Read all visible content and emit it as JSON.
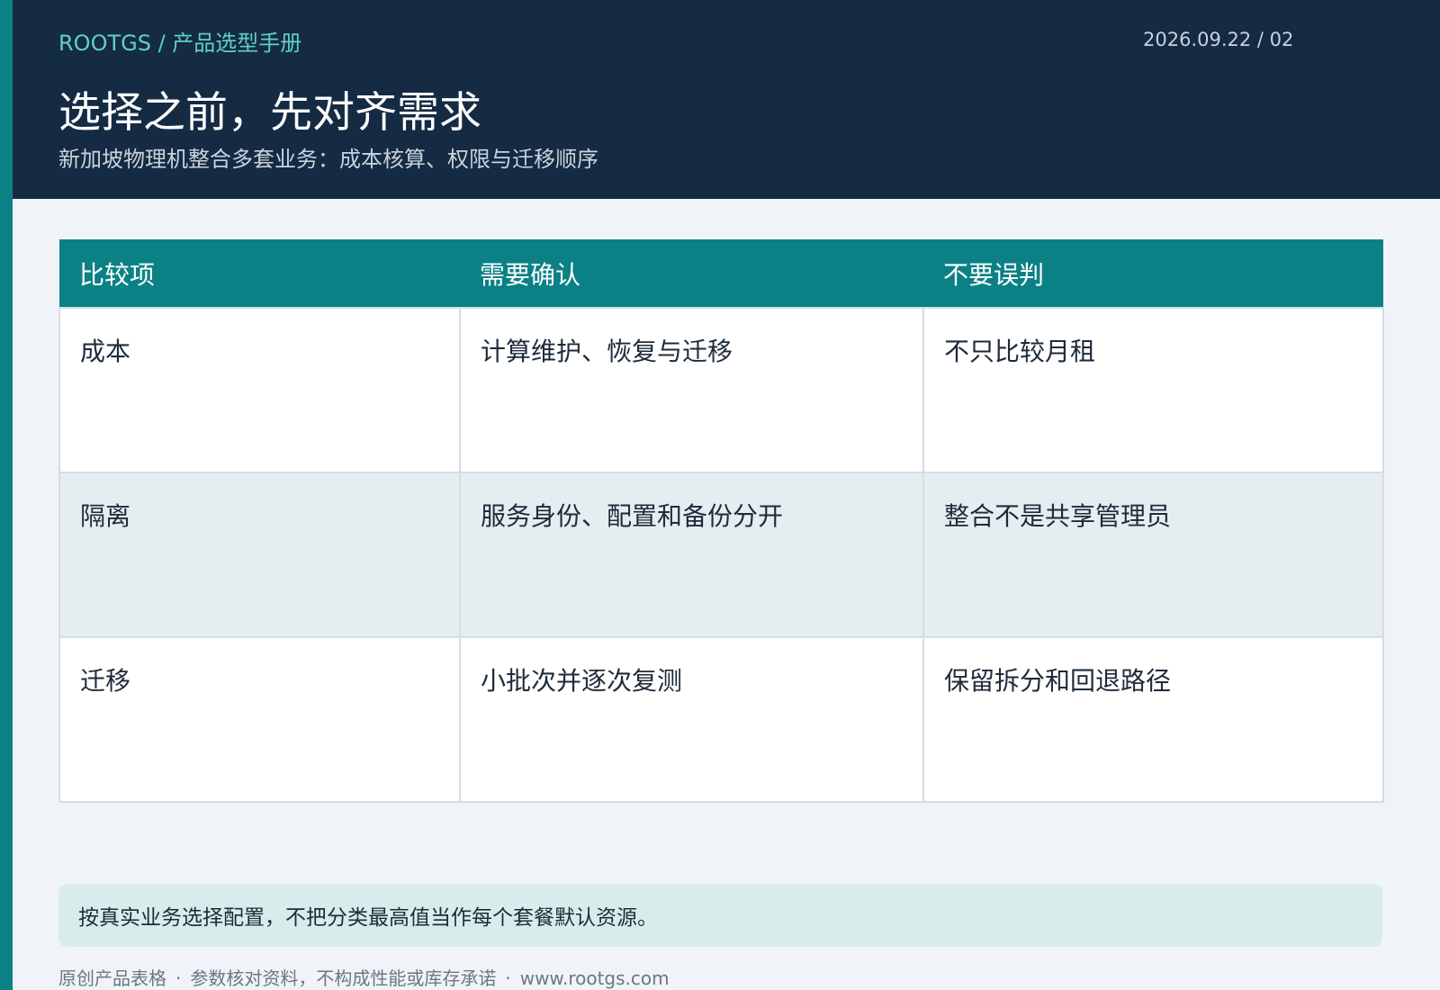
{
  "header": {
    "breadcrumb": "ROOTGS / 产品选型手册",
    "meta": "2026.09.22 / 02",
    "title": "选择之前，先对齐需求",
    "subtitle": "新加坡物理机整合多套业务：成本核算、权限与迁移顺序"
  },
  "table": {
    "headers": [
      "比较项",
      "需要确认",
      "不要误判"
    ],
    "rows": [
      [
        "成本",
        "计算维护、恢复与迁移",
        "不只比较月租"
      ],
      [
        "隔离",
        "服务身份、配置和备份分开",
        "整合不是共享管理员"
      ],
      [
        "迁移",
        "小批次并逐次复测",
        "保留拆分和回退路径"
      ]
    ]
  },
  "note": "按真实业务选择配置，不把分类最高值当作每个套餐默认资源。",
  "footer": {
    "items": [
      "原创产品表格",
      "参数核对资料，不构成性能或库存承诺",
      "www.rootgs.com"
    ],
    "separator": "·"
  },
  "colors": {
    "accent": "#0b8186",
    "header_bg": "#152a43",
    "breadcrumb": "#5fcfc9",
    "page_bg": "#f0f4f8",
    "note_bg": "#d9ecec"
  }
}
